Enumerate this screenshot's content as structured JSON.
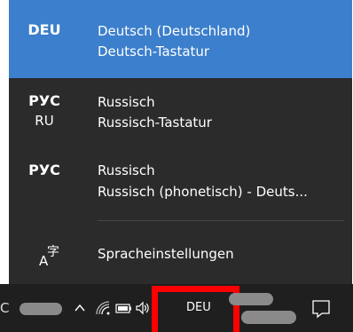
{
  "language_flyout": {
    "items": [
      {
        "code": "DEU",
        "sub_code": "",
        "name": "Deutsch (Deutschland)",
        "layout": "Deutsch-Tastatur",
        "selected": true
      },
      {
        "code": "РУС",
        "sub_code": "RU",
        "name": "Russisch",
        "layout": "Russisch-Tastatur",
        "selected": false
      },
      {
        "code": "РУС",
        "sub_code": "",
        "name": "Russisch",
        "layout": "Russisch (phonetisch) - Deuts...",
        "selected": false
      }
    ],
    "settings_label": "Spracheinstellungen"
  },
  "taskbar": {
    "truncated_text": "C",
    "language_indicator": "DEU",
    "tray_icons": [
      "chevron-up-icon",
      "network-icon",
      "battery-icon",
      "volume-icon",
      "notification-icon"
    ]
  },
  "colors": {
    "flyout_background": "#2b2b2b",
    "selected_background": "#3c7fcc",
    "taskbar_background": "#1f1f1f",
    "highlight_box": "#ff0000"
  }
}
